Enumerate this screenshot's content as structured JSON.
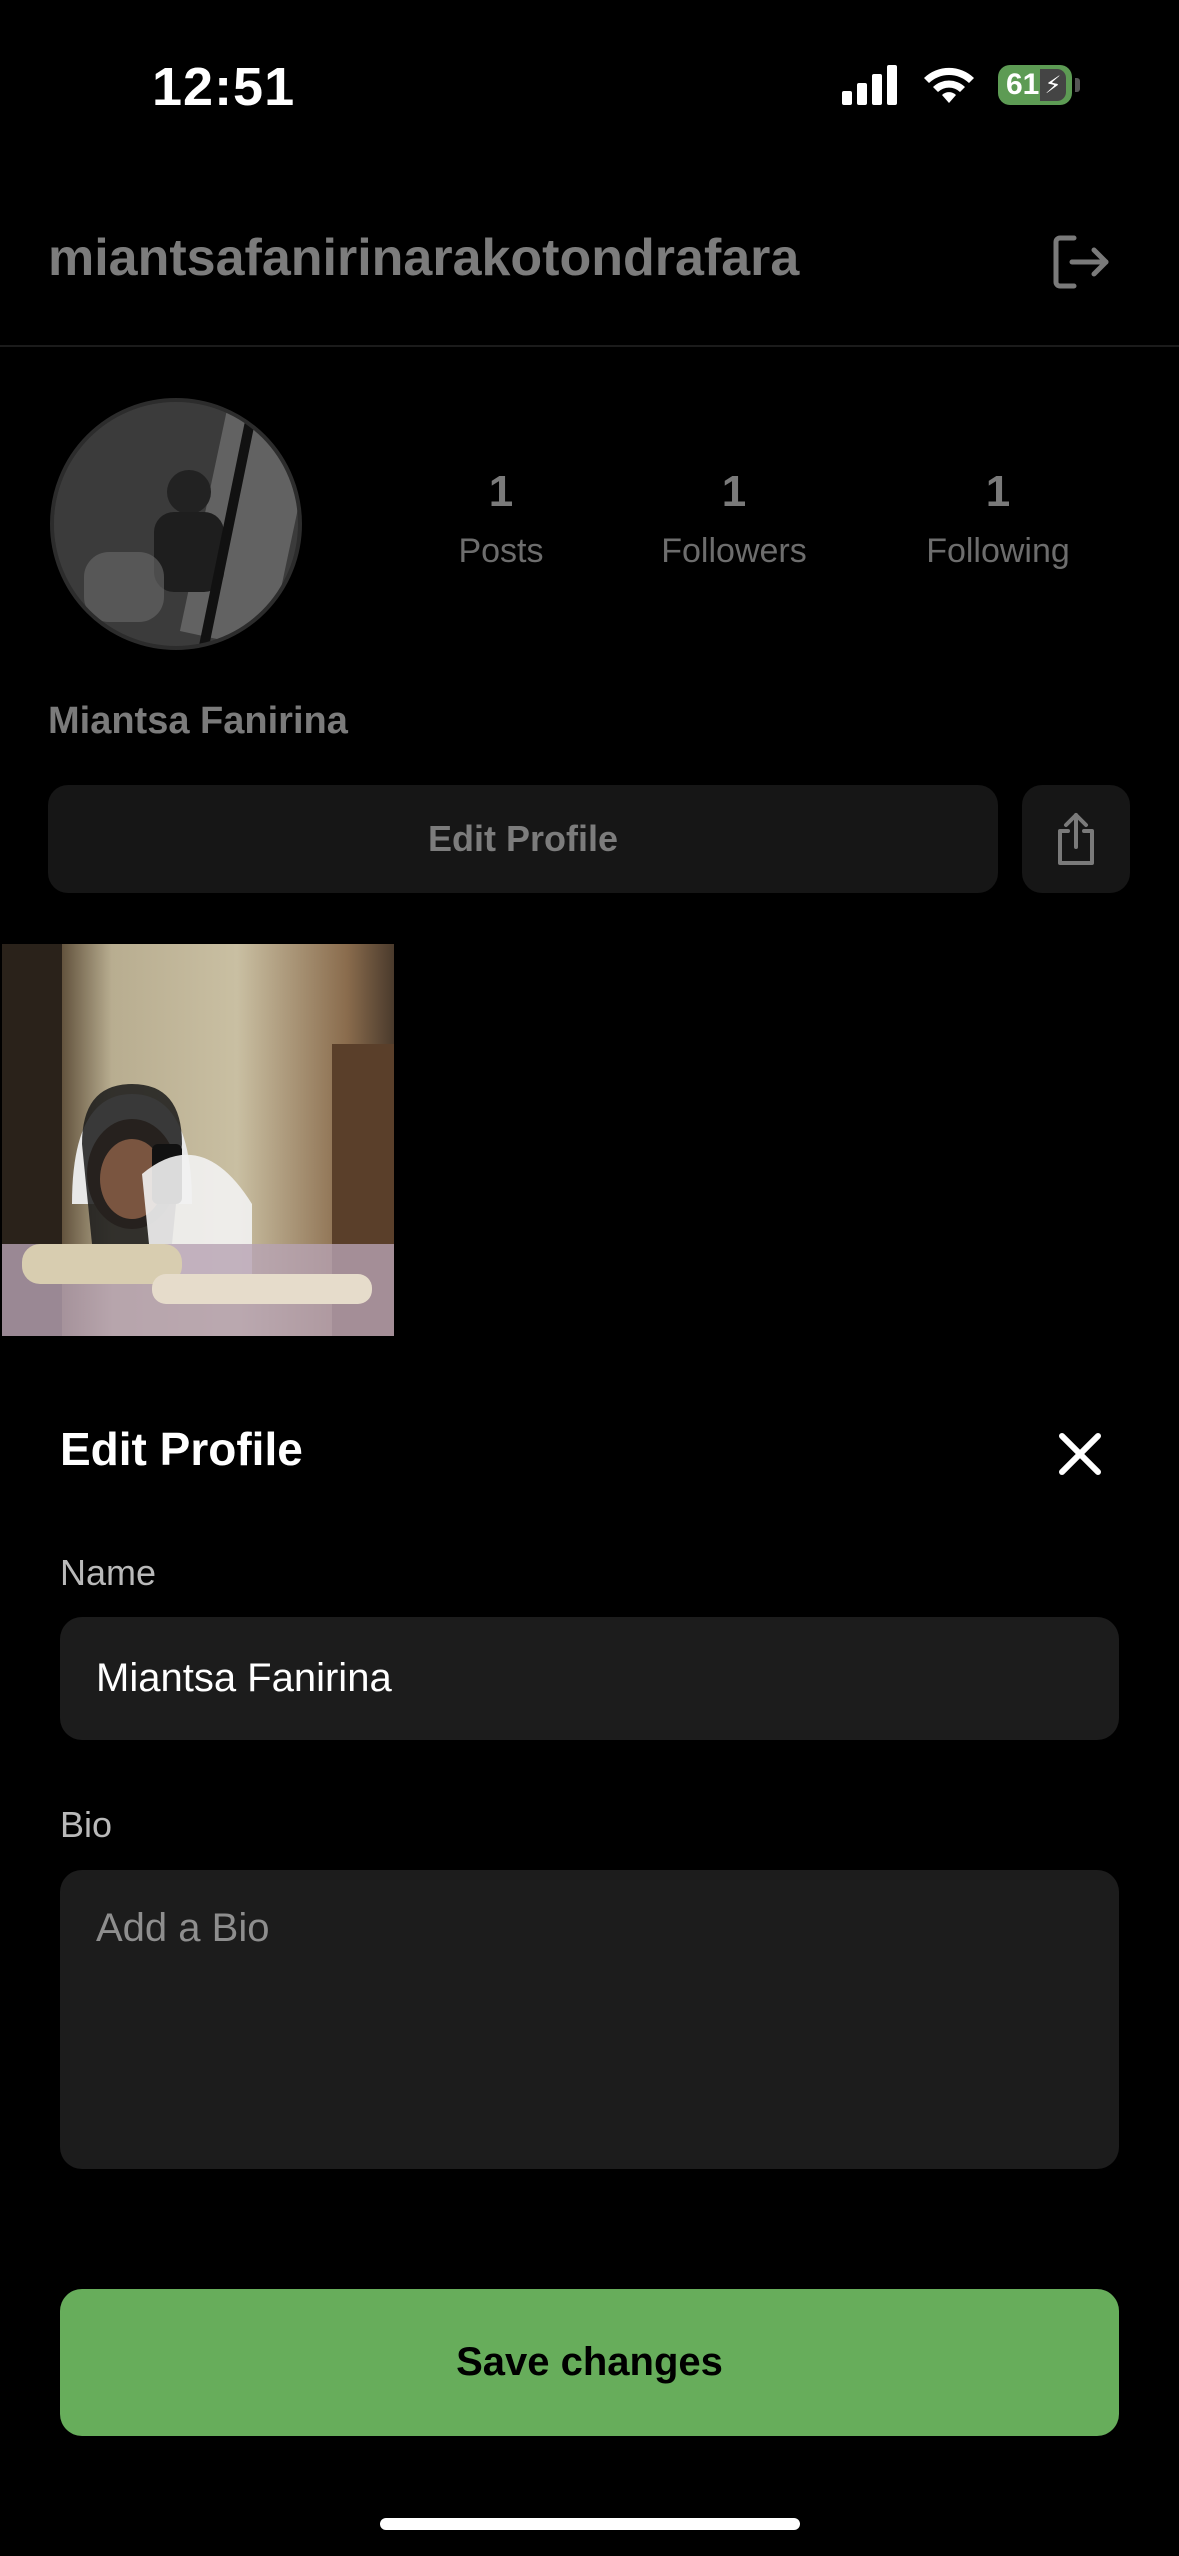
{
  "status_bar": {
    "time": "12:51",
    "battery_level": "61",
    "icons": [
      "signal-icon",
      "wifi-icon",
      "battery-charging-icon"
    ]
  },
  "header": {
    "username": "miantsafanirinarakotondrafara",
    "logout_icon": "logout-icon"
  },
  "profile": {
    "avatar": "avatar",
    "stats": [
      {
        "value": "1",
        "label": "Posts"
      },
      {
        "value": "1",
        "label": "Followers"
      },
      {
        "value": "1",
        "label": "Following"
      }
    ],
    "display_name": "Miantsa Fanirina",
    "edit_button_label": "Edit Profile",
    "share_icon": "share-icon"
  },
  "posts": {
    "count_shown": 1
  },
  "edit_sheet": {
    "title": "Edit Profile",
    "close_icon": "close-icon",
    "name_label": "Name",
    "name_value": "Miantsa Fanirina",
    "bio_label": "Bio",
    "bio_value": "",
    "bio_placeholder": "Add a Bio",
    "save_label": "Save changes"
  },
  "colors": {
    "background": "#000000",
    "accent_green": "#67ad5b",
    "input_bg": "#1c1c1c",
    "dim_text": "#7c7c7c"
  }
}
